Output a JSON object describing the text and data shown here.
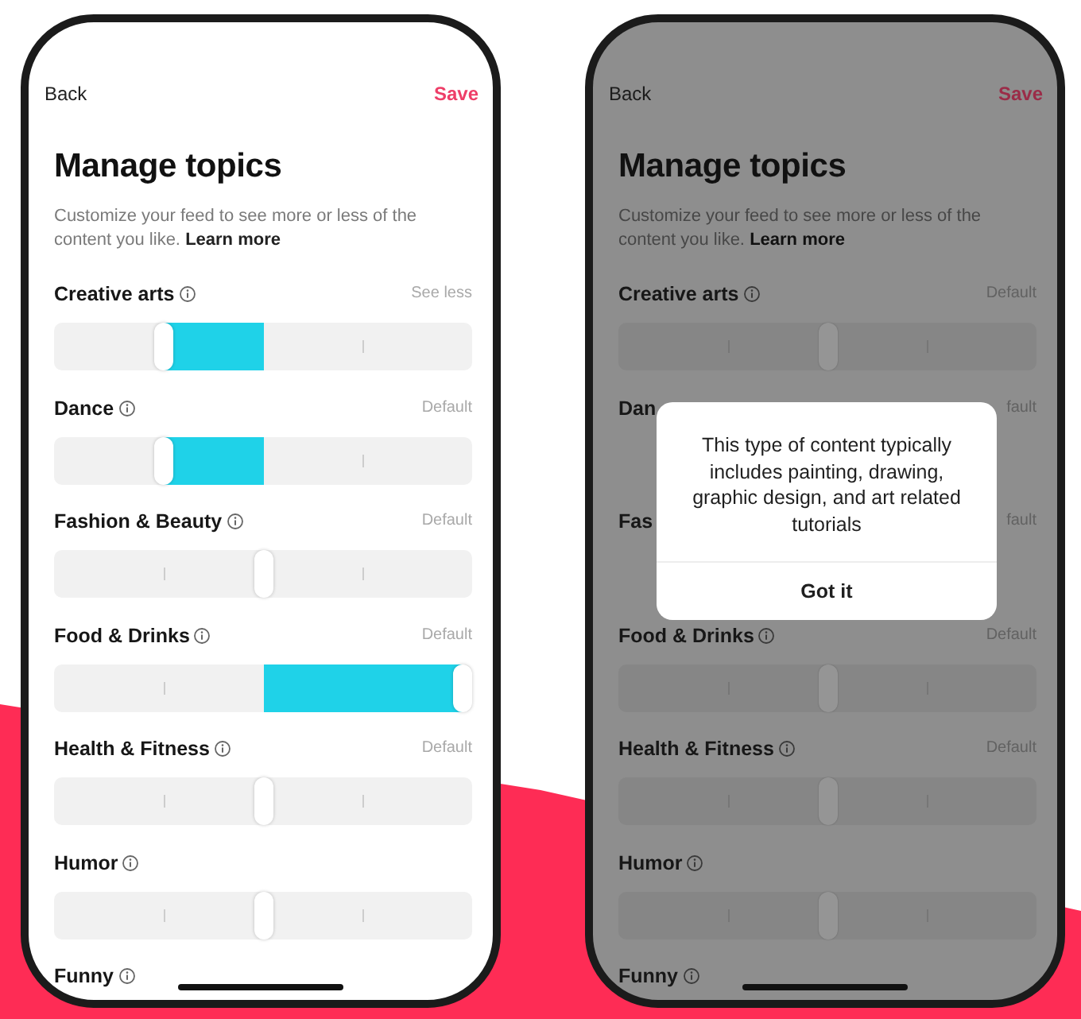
{
  "screens": [
    {
      "dimmed": false,
      "back": "Back",
      "save": "Save",
      "title": "Manage topics",
      "description": "Customize your feed to see more or less of the content you like.",
      "learn_more": "Learn more",
      "topics": [
        {
          "name": "Creative arts",
          "info": true,
          "status": "See less",
          "kind": "slider",
          "level": 0.25
        },
        {
          "name": "Dance",
          "info": true,
          "status": "Default",
          "kind": "slider",
          "level": 0.25
        },
        {
          "name": "Fashion & Beauty",
          "info": true,
          "status": "Default",
          "kind": "slider",
          "level": 0.5
        },
        {
          "name": "Food & Drinks",
          "info": true,
          "status": "Default",
          "kind": "slider",
          "level": 1
        },
        {
          "name": "Health & Fitness",
          "info": true,
          "status": "Default",
          "kind": "slider",
          "level": 0.5
        },
        {
          "name": "Humor",
          "info": true,
          "kind": "slider",
          "level": 0.5
        },
        {
          "name": "Funny",
          "info": true,
          "kind": "label"
        }
      ]
    },
    {
      "dimmed": true,
      "back": "Back",
      "save": "Save",
      "title": "Manage topics",
      "description": "Customize your feed to see more or less of the content you like.",
      "learn_more": "Learn more",
      "topics": [
        {
          "name": "Creative arts",
          "info": true,
          "status": "Default",
          "kind": "slider",
          "level": 0.5
        },
        {
          "name": "Dan",
          "info": false,
          "status": "fault",
          "kind": "label"
        },
        {
          "name": "Fas",
          "info": false,
          "status": "fault",
          "kind": "label"
        },
        {
          "name": "Food & Drinks",
          "info": true,
          "status": "Default",
          "kind": "slider",
          "level": 0.5
        },
        {
          "name": "Health & Fitness",
          "info": true,
          "status": "Default",
          "kind": "slider",
          "level": 0.5
        },
        {
          "name": "Humor",
          "info": true,
          "kind": "slider",
          "level": 0.5
        },
        {
          "name": "Funny",
          "info": true,
          "kind": "label"
        }
      ],
      "dialog": {
        "message": "This type of content typically includes painting, drawing, graphic design, and art related tutorials",
        "button": "Got it"
      }
    }
  ]
}
